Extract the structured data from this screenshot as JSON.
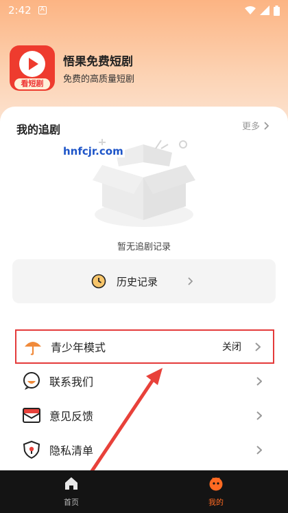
{
  "status_bar": {
    "time": "2:42",
    "notification_icon": "A"
  },
  "app": {
    "name": "悟果免费短剧",
    "subtitle": "免费的高质量短剧",
    "logo_text": "看短剧"
  },
  "watching": {
    "title": "我的追剧",
    "more_label": "更多",
    "empty_text": "暂无追剧记录"
  },
  "history": {
    "label": "历史记录"
  },
  "watermark": "hnfcjr.com",
  "menu": [
    {
      "label": "青少年模式",
      "value": "关闭",
      "icon": "umbrella-icon"
    },
    {
      "label": "联系我们",
      "value": "",
      "icon": "chat-bubble-icon"
    },
    {
      "label": "意见反馈",
      "value": "",
      "icon": "envelope-icon"
    },
    {
      "label": "隐私清单",
      "value": "",
      "icon": "shield-icon"
    }
  ],
  "bottom_nav": [
    {
      "label": "首页",
      "icon": "home-icon",
      "active": false
    },
    {
      "label": "我的",
      "icon": "profile-icon",
      "active": true
    }
  ],
  "colors": {
    "accent": "#ff6a22",
    "highlight_border": "#e43a3a",
    "annotation_arrow": "#e8413a",
    "nav_bg": "#141414"
  }
}
